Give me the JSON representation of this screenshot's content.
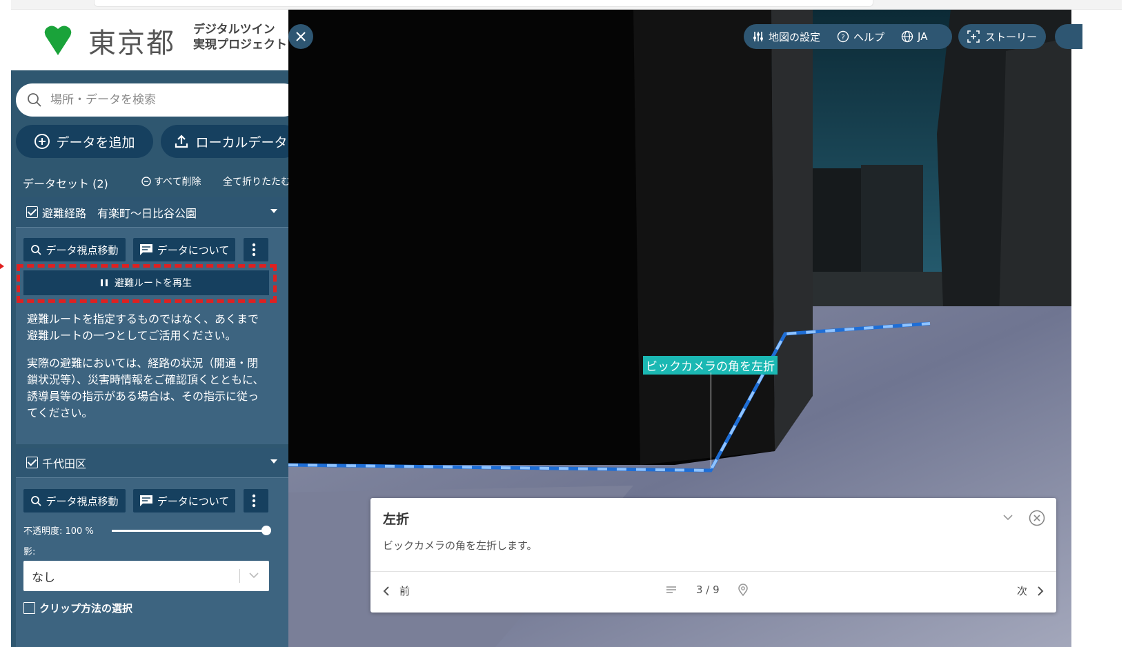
{
  "brand": {
    "name": "東京都",
    "subtitle_line1": "デジタルツイン",
    "subtitle_line2": "実現プロジェクト",
    "color": "#1aa33a"
  },
  "search": {
    "placeholder": "場所・データを検索"
  },
  "actions": {
    "add_data": "データを追加",
    "local_data": "ローカルデータ"
  },
  "datasets": {
    "count_label": "データセット (2)",
    "delete_all": "すべて削除",
    "collapse_all": "全て折りたたむ",
    "items": [
      {
        "title": "避難経路　有楽町〜日比谷公園",
        "checked": true,
        "move_label": "データ視点移動",
        "about_label": "データについて",
        "play_label": "避難ルートを再生",
        "note1": "避難ルートを指定するものではなく、あくまで避難ルートの一つとしてご活用ください。",
        "note2": "実際の避難においては、経路の状況（開通・閉鎖状況等）、災害時情報をご確認頂くとともに、誘導員等の指示がある場合は、その指示に従ってください。"
      },
      {
        "title": "千代田区",
        "checked": true,
        "move_label": "データ視点移動",
        "about_label": "データについて",
        "opacity_label": "不透明度: 100 %",
        "opacity_value": 1.0,
        "shadow_label": "影:",
        "shadow_value": "なし",
        "clip_label": "クリップ方法の選択",
        "clip_checked": false
      }
    ]
  },
  "map_toolbar": {
    "map_settings": "地図の設定",
    "help": "ヘルプ",
    "language": "JA",
    "story": "ストーリー"
  },
  "map": {
    "route_label": "ビックカメラの角を左折",
    "route_color": "#3a8cf0"
  },
  "story_panel": {
    "title": "左折",
    "description": "ビックカメラの角を左折します。",
    "prev": "前",
    "next": "次",
    "page": "3 / 9"
  },
  "colors": {
    "sidebar": "#2f5770",
    "button": "#16405f",
    "highlight": "#e02020",
    "label_bg": "#1bb8b3"
  }
}
